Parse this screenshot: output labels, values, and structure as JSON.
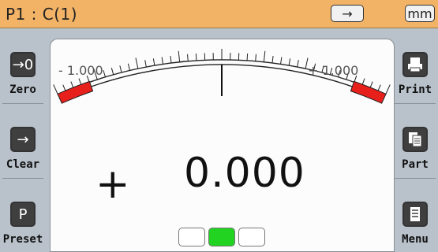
{
  "header": {
    "title": "P1 : C(1)",
    "arrow_label": "→",
    "unit": "mm"
  },
  "left_buttons": [
    {
      "label": "Zero",
      "icon": "→0",
      "icon_name": "zero-icon"
    },
    {
      "label": "Clear",
      "icon": "→",
      "icon_name": "arrow-right-icon"
    },
    {
      "label": "Preset",
      "icon": "P",
      "icon_name": "preset-p-icon"
    }
  ],
  "right_buttons": [
    {
      "label": "Print",
      "icon_name": "printer-icon"
    },
    {
      "label": "Part",
      "icon_name": "document-icon"
    },
    {
      "label": "Menu",
      "icon_name": "menu-list-icon"
    }
  ],
  "gauge": {
    "min_label": "- 1.000",
    "max_label": "+ 1.000",
    "value": 0.0
  },
  "reading": {
    "sign": "+",
    "value": "0.000"
  },
  "status_lights": [
    "off",
    "on",
    "off"
  ],
  "colors": {
    "header_bg": "#f2b366",
    "tolerance_red": "#e8201c",
    "indicator_green": "#22d322",
    "panel_bg": "#fcfcfd",
    "side_bg": "#b9c2cb"
  }
}
